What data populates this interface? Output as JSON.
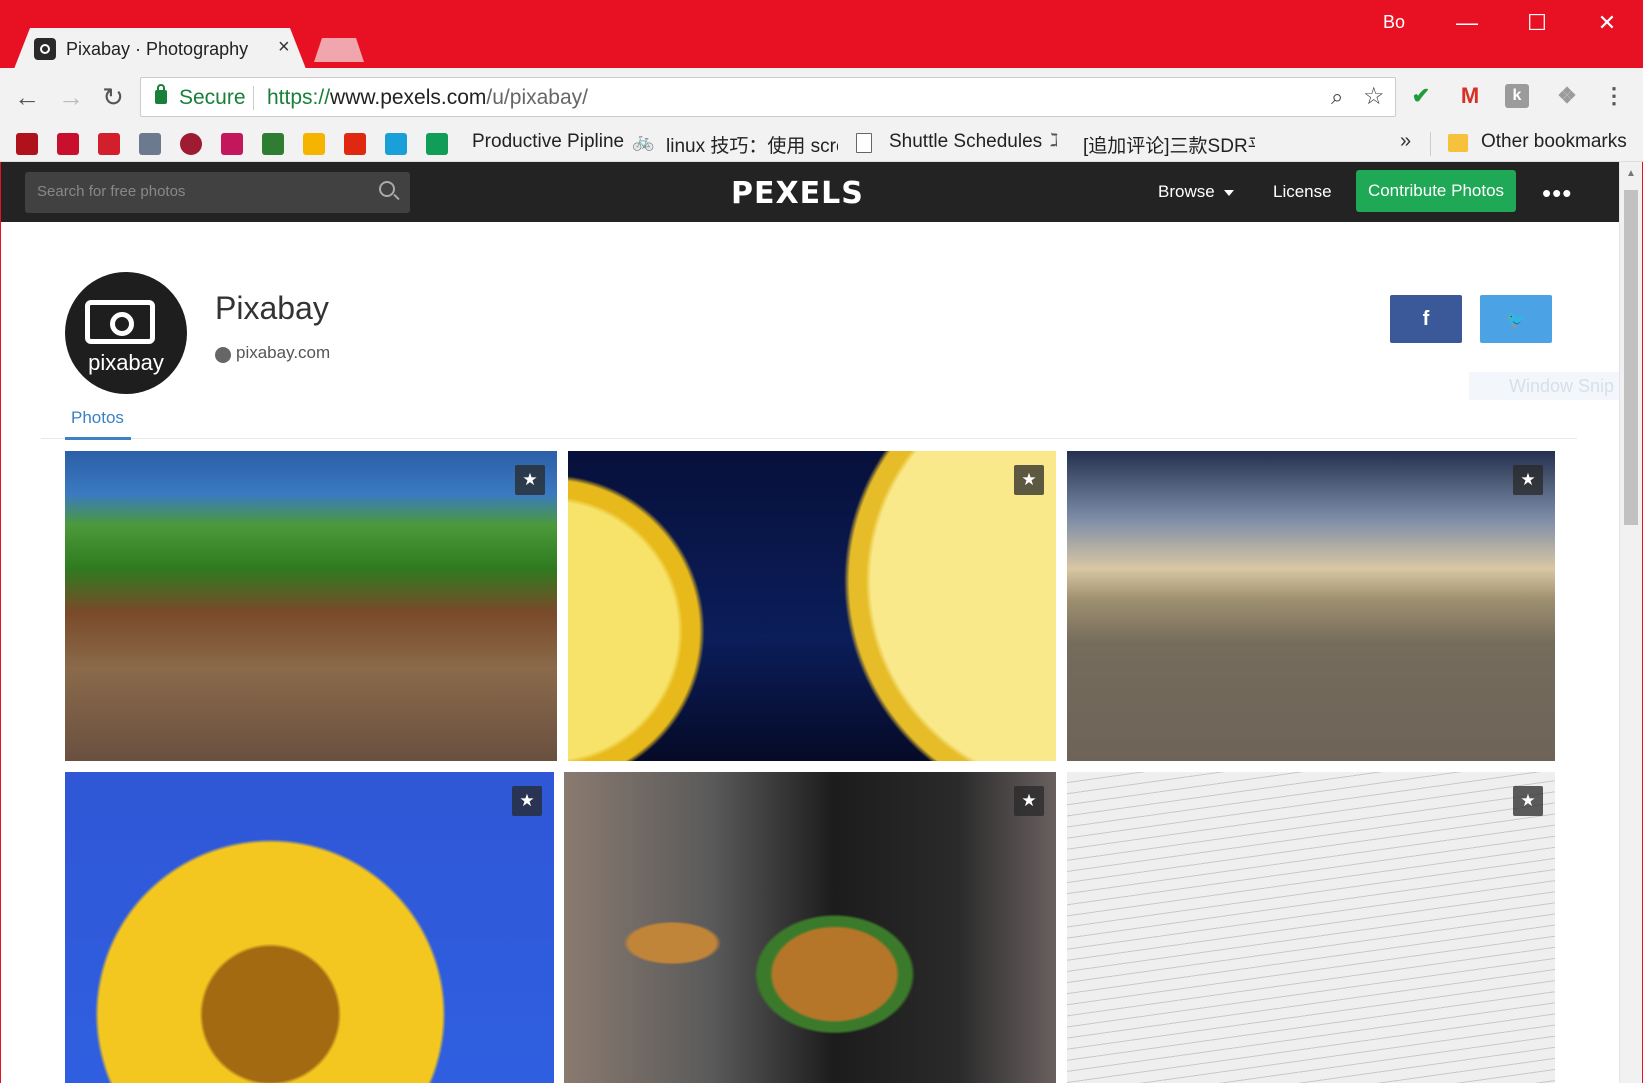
{
  "browser": {
    "tab_title": "Pixabay · Photography",
    "tab_close": "×",
    "profile_name": "Bo",
    "window_controls": {
      "minimize": "—",
      "maximize": "☐",
      "close": "✕"
    },
    "nav": {
      "back": "←",
      "forward": "→",
      "reload": "↻"
    },
    "address": {
      "secure_label": "Secure",
      "url_scheme": "https://",
      "url_host": "www.pexels.com",
      "url_path": "/u/pixabay/"
    },
    "extensions": {
      "check": "✔",
      "gmail": "M",
      "grammarly": "k",
      "dropbox": "❖",
      "menu": "⋮"
    },
    "bookmarks": [
      {
        "icon": "bookmark-icon-grid",
        "color": "#b0121b"
      },
      {
        "icon": "bookmark-icon-taichi",
        "color": "#c8102e"
      },
      {
        "icon": "bookmark-icon-red-square",
        "color": "#d31f2b"
      },
      {
        "icon": "bookmark-icon-globe",
        "color": "#6b7a8f"
      },
      {
        "icon": "bookmark-icon-ring",
        "color": "#9e1b32"
      },
      {
        "icon": "bookmark-icon-l",
        "color": "#c2185b"
      },
      {
        "icon": "bookmark-icon-douban",
        "color": "#2e7d32"
      },
      {
        "icon": "bookmark-icon-drive",
        "color": "#f4b400"
      },
      {
        "icon": "bookmark-icon-flag",
        "color": "#de2910"
      },
      {
        "icon": "bookmark-icon-circle-e",
        "color": "#1a9fd9"
      },
      {
        "icon": "bookmark-icon-sheets",
        "color": "#0f9d58"
      }
    ],
    "bookmark_links": {
      "productive": "Productive Pipline",
      "linux": "linux 技巧：使用 scre",
      "shuttle": "Shuttle Schedules",
      "sdr": "[追加评论]三款SDR平"
    },
    "bookmarks_more": "»",
    "other_bookmarks": "Other bookmarks"
  },
  "site": {
    "search_placeholder": "Search for free photos",
    "logo": "PEXELS",
    "nav_browse": "Browse",
    "nav_license": "License",
    "contribute": "Contribute Photos",
    "more": "•••"
  },
  "profile": {
    "avatar_text": "pixabay",
    "name": "Pixabay",
    "website": "pixabay.com",
    "facebook": "f",
    "twitter": "🐦",
    "overlay_text": "Window Snip"
  },
  "tabs": {
    "photos": "Photos"
  },
  "photos": [
    {
      "subject": "railway bridge over green hills",
      "star": "★"
    },
    {
      "subject": "lemon slices with bubbles",
      "star": "★"
    },
    {
      "subject": "railway tracks under dramatic sky",
      "star": "★"
    },
    {
      "subject": "sunflower against blue sky",
      "star": "★"
    },
    {
      "subject": "person holding two burgers",
      "star": "★"
    },
    {
      "subject": "sheet music",
      "star": "★"
    }
  ],
  "colors": {
    "chrome_red": "#e81123",
    "header_dark": "#232323",
    "contribute_green": "#1fa855",
    "facebook_blue": "#3b5998",
    "twitter_blue": "#4ba3e6",
    "link_blue": "#3b82c4"
  }
}
